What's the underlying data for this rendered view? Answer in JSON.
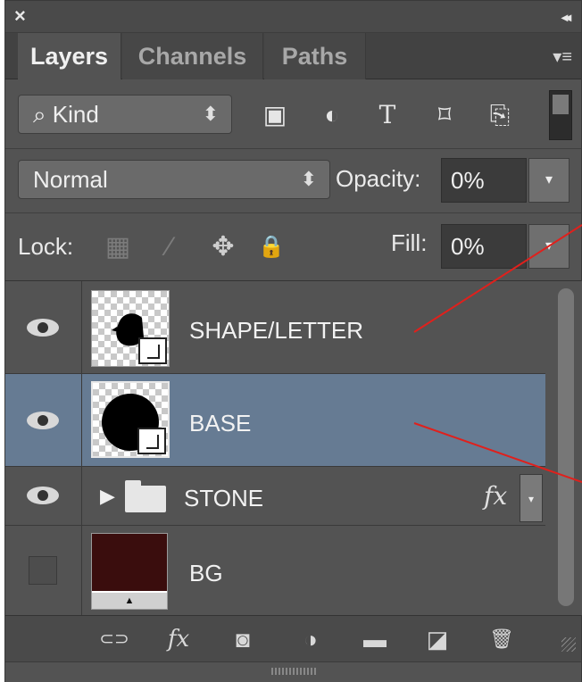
{
  "panel": {
    "close_glyph": "×",
    "collapse_glyph": "◂◂",
    "menu_glyph": "▾≡"
  },
  "tabs": [
    {
      "label": "Layers",
      "active": true
    },
    {
      "label": "Channels",
      "active": false
    },
    {
      "label": "Paths",
      "active": false
    }
  ],
  "filter": {
    "kind_label": "Kind",
    "search_glyph": "⌕",
    "arrows": "⬍",
    "icons": [
      "image-filter-icon",
      "adjustment-filter-icon",
      "type-filter-icon",
      "shape-filter-icon",
      "smart-object-filter-icon"
    ],
    "icon_glyphs": [
      "▣",
      "◐",
      "T",
      "⌑",
      "⎘"
    ]
  },
  "blend": {
    "mode": "Normal",
    "arrows": "⬍",
    "opacity_label": "Opacity:",
    "opacity_value": "0%",
    "dropdown_glyph": "▾"
  },
  "lock": {
    "label": "Lock:",
    "icon_glyphs": [
      "▦",
      "⁄",
      "✥",
      "🔒"
    ],
    "fill_label": "Fill:",
    "fill_value": "0%",
    "dropdown_glyph": "▾"
  },
  "layers": [
    {
      "name": "SHAPE/LETTER",
      "visible": true,
      "selected": false,
      "type": "smart-object"
    },
    {
      "name": "BASE",
      "visible": true,
      "selected": true,
      "type": "smart-object"
    },
    {
      "name": "STONE",
      "visible": true,
      "selected": false,
      "type": "group",
      "has_fx": true,
      "fx_label": "fx",
      "disclosure": "▶",
      "expand_glyph": "▾"
    },
    {
      "name": "BG",
      "visible": false,
      "selected": false,
      "type": "fill"
    }
  ],
  "toolbar": {
    "icons": [
      "link-layers-icon",
      "add-layer-style-icon",
      "add-mask-icon",
      "new-adjustment-layer-icon",
      "new-group-icon",
      "new-layer-icon",
      "delete-layer-icon"
    ],
    "glyphs": [
      "⊂⊃",
      "fx",
      "◙",
      "◑",
      "▬",
      "◪",
      "🗑"
    ]
  },
  "colors": {
    "panel_bg": "#535353",
    "selected_row": "#667b93",
    "annotation_line": "#e0201c",
    "bg_swatch": "#3a0d0d"
  }
}
